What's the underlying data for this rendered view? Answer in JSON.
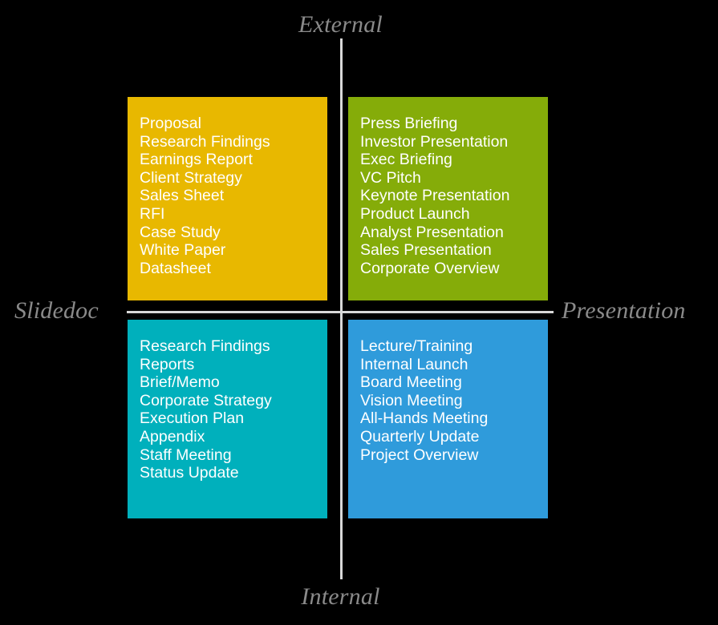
{
  "diagram": {
    "title": "Slidedoc vs Presentation / External vs Internal matrix",
    "axes": {
      "top_label": "External",
      "bottom_label": "Internal",
      "left_label": "Slidedoc",
      "right_label": "Presentation"
    },
    "colors": {
      "background": "#000000",
      "axis_line": "#d8d8d8",
      "axis_label_text": "#8a8a8a",
      "item_text": "#ffffff",
      "top_left": "#e8b800",
      "top_right": "#85ac09",
      "bottom_left": "#00b0bc",
      "bottom_right": "#2f9bdb"
    },
    "quadrants": [
      {
        "id": "external-slidedoc",
        "position": "top-left",
        "color": "#e8b800",
        "items": [
          "Proposal",
          "Research Findings",
          "Earnings Report",
          "Client Strategy",
          "Sales Sheet",
          "RFI",
          "Case Study",
          "White Paper",
          "Datasheet"
        ]
      },
      {
        "id": "external-presentation",
        "position": "top-right",
        "color": "#85ac09",
        "items": [
          "Press Briefing",
          "Investor Presentation",
          "Exec Briefing",
          "VC Pitch",
          "Keynote Presentation",
          "Product Launch",
          "Analyst Presentation",
          "Sales Presentation",
          "Corporate Overview"
        ]
      },
      {
        "id": "internal-slidedoc",
        "position": "bottom-left",
        "color": "#00b0bc",
        "items": [
          "Research Findings",
          "Reports",
          "Brief/Memo",
          "Corporate Strategy",
          "Execution Plan",
          "Appendix",
          "Staff Meeting",
          "Status Update"
        ]
      },
      {
        "id": "internal-presentation",
        "position": "bottom-right",
        "color": "#2f9bdb",
        "items": [
          "Lecture/Training",
          "Internal Launch",
          "Board Meeting",
          "Vision Meeting",
          "All-Hands Meeting",
          "Quarterly Update",
          "Project Overview"
        ]
      }
    ]
  }
}
